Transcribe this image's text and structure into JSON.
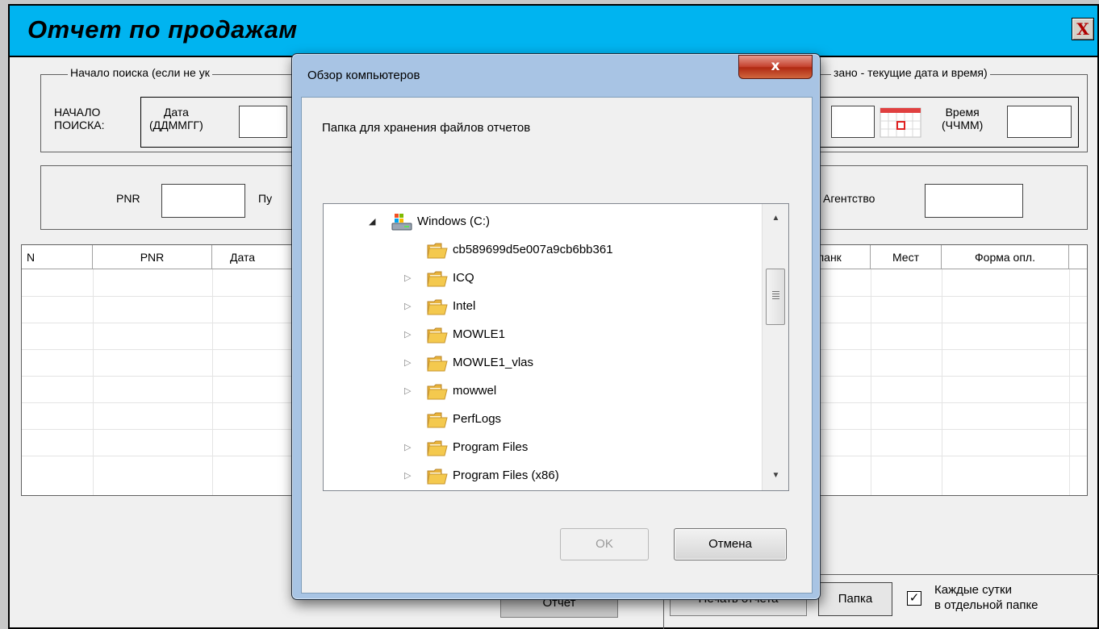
{
  "main": {
    "title": "Отчет по продажам",
    "close_glyph": "X",
    "search_group": {
      "legend_left": "Начало поиска (если не ук",
      "legend_right": "зано - текущие дата и время)"
    },
    "start_label_1": "НАЧАЛО",
    "start_label_2": "ПОИСКА:",
    "date_label_1": "Дата",
    "date_label_2": "(ДДММГГ)",
    "date_value": "",
    "date2_value": "",
    "time_label_1": "Время",
    "time_label_2": "(ЧЧММ)",
    "time_value": "",
    "pnr_label": "PNR",
    "pnr_value": "",
    "pu_label": "Пу",
    "agency_label": "Агентство",
    "agency_value": "",
    "table": {
      "columns": [
        "N",
        "PNR",
        "Дата",
        "ланк",
        "Мест",
        "Форма опл."
      ]
    },
    "report_button": "Отчет",
    "print_button": "Печать отчета",
    "folder_button": "Папка",
    "daily_check_mark": "✓",
    "daily_label_1": "Каждые сутки",
    "daily_label_2": "в отдельной папке"
  },
  "dialog": {
    "title": "Обзор компьютеров",
    "close_glyph": "x",
    "description": "Папка для хранения файлов отчетов",
    "tree": [
      {
        "label": "Windows  (C:)",
        "arrow": "◢",
        "icon": "drive-icon",
        "level": 0
      },
      {
        "label": "cb589699d5e007a9cb6bb361",
        "arrow": "",
        "icon": "folder-icon",
        "level": 1
      },
      {
        "label": "ICQ",
        "arrow": "▷",
        "icon": "folder-icon",
        "level": 1
      },
      {
        "label": "Intel",
        "arrow": "▷",
        "icon": "folder-icon",
        "level": 1
      },
      {
        "label": "MOWLE1",
        "arrow": "▷",
        "icon": "folder-icon",
        "level": 1
      },
      {
        "label": "MOWLE1_vlas",
        "arrow": "▷",
        "icon": "folder-icon",
        "level": 1
      },
      {
        "label": "mowwel",
        "arrow": "▷",
        "icon": "folder-icon",
        "level": 1
      },
      {
        "label": "PerfLogs",
        "arrow": "",
        "icon": "folder-icon",
        "level": 1
      },
      {
        "label": "Program Files",
        "arrow": "▷",
        "icon": "folder-icon",
        "level": 1
      },
      {
        "label": "Program Files (x86)",
        "arrow": "▷",
        "icon": "folder-icon",
        "level": 1
      }
    ],
    "scroll_up": "▲",
    "scroll_down": "▼",
    "ok_button": "OK",
    "cancel_button": "Отмена"
  },
  "colors": {
    "title_bar": "#00b4f0",
    "dialog_frame": "#a8c4e4",
    "close_red": "#c5402c"
  }
}
